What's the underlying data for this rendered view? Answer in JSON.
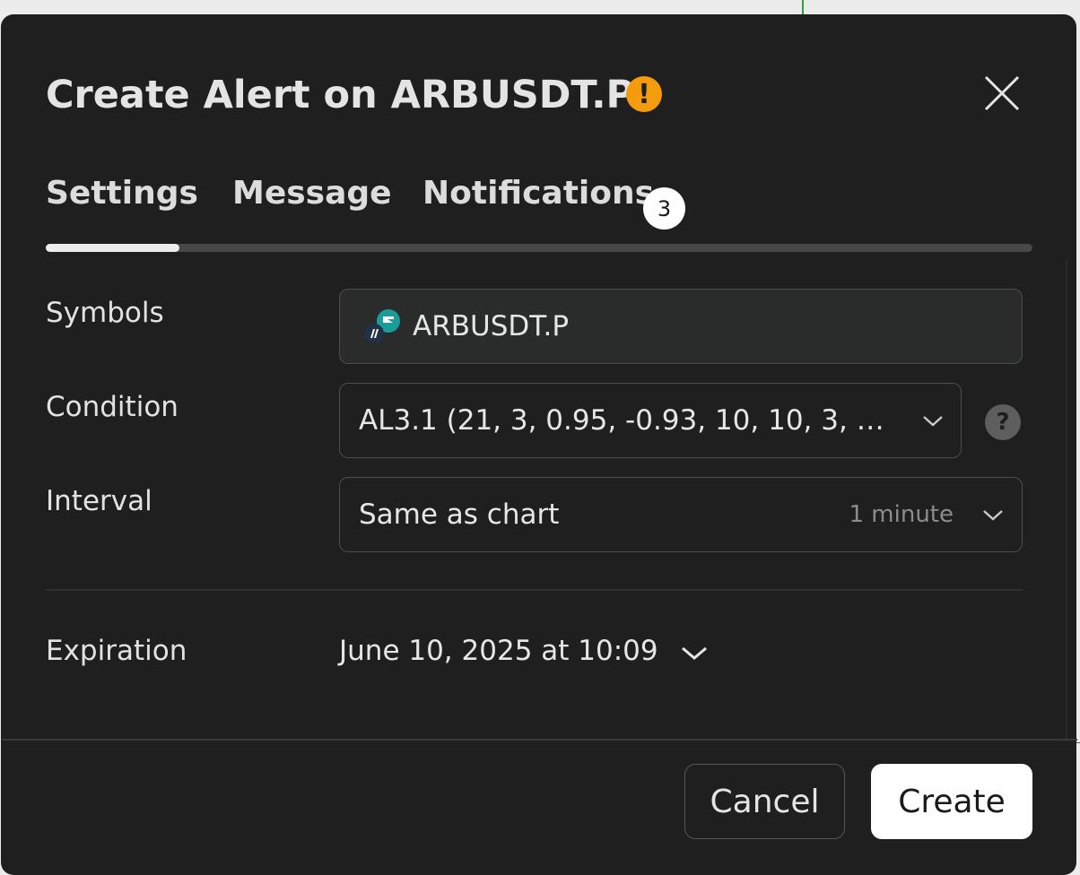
{
  "dialog": {
    "title": "Create Alert on ARBUSDT.P",
    "warning_icon": "exclamation-circle-icon",
    "warning_color": "#f59b0e",
    "close_icon": "close-icon"
  },
  "tabs": [
    {
      "label": "Settings",
      "active": true
    },
    {
      "label": "Message",
      "active": false
    },
    {
      "label": "Notifications",
      "active": false,
      "badge": "3"
    }
  ],
  "form": {
    "symbols": {
      "label": "Symbols",
      "value": "ARBUSDT.P",
      "icon": "arbitrum-symbol-icon"
    },
    "condition": {
      "label": "Condition",
      "value": "AL3.1 (21, 3, 0.95, -0.93, 10, 10, 3, …",
      "help_icon": "question-circle-icon"
    },
    "interval": {
      "label": "Interval",
      "value": "Same as chart",
      "hint": "1 minute"
    },
    "expiration": {
      "label": "Expiration",
      "value": "June 10, 2025 at 10:09"
    }
  },
  "footer": {
    "cancel_label": "Cancel",
    "create_label": "Create"
  },
  "colors": {
    "dialog_bg": "#1f1f1f",
    "accent_warning": "#f59b0e",
    "primary_button": "#ffffff"
  }
}
